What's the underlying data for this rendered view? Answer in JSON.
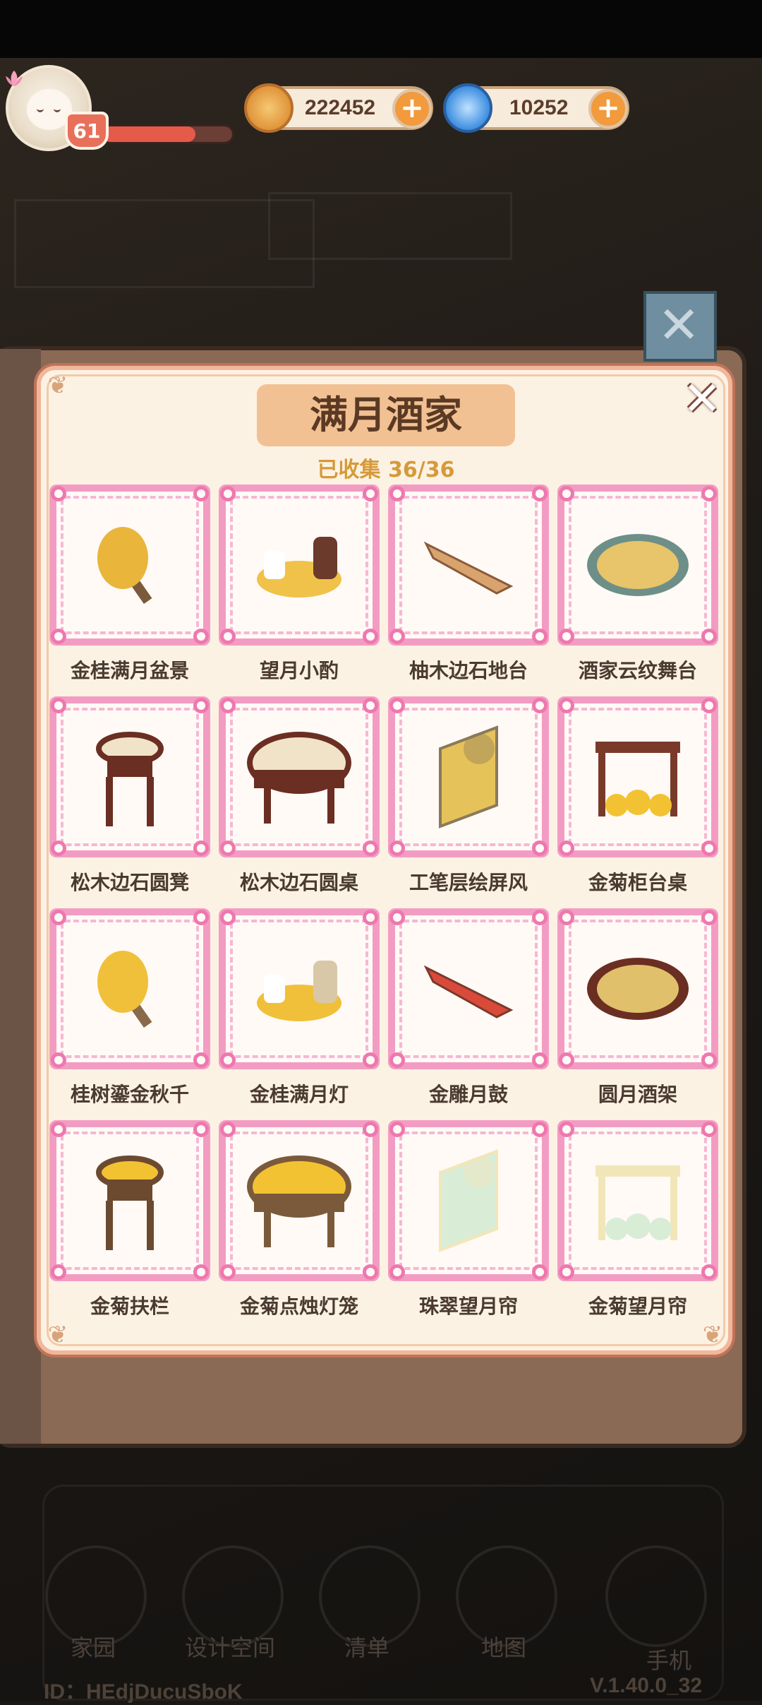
{
  "hud": {
    "level": "61",
    "xp_fraction": 0.72,
    "coins": "222452",
    "gems": "10252",
    "plus_symbol": "+"
  },
  "collection": {
    "title": "满月酒家",
    "progress": "已收集 36/36",
    "close_symbol": "✕",
    "items": [
      {
        "label": "金桂满月盆景",
        "icon": "golden-osmanthus-bonsai-icon"
      },
      {
        "label": "望月小酌",
        "icon": "wine-set-icon"
      },
      {
        "label": "柚木边石地台",
        "icon": "wooden-platform-icon"
      },
      {
        "label": "酒家云纹舞台",
        "icon": "round-stage-icon"
      },
      {
        "label": "松木边石圆凳",
        "icon": "round-stool-icon"
      },
      {
        "label": "松木边石圆桌",
        "icon": "round-table-icon"
      },
      {
        "label": "工笔层绘屏风",
        "icon": "painted-screen-icon"
      },
      {
        "label": "金菊柜台桌",
        "icon": "chrysanthemum-counter-icon"
      },
      {
        "label": "桂树鎏金秋千",
        "icon": "osmanthus-swing-icon"
      },
      {
        "label": "金桂满月灯",
        "icon": "osmanthus-lantern-icon"
      },
      {
        "label": "金雕月鼓",
        "icon": "moon-drum-icon"
      },
      {
        "label": "圆月酒架",
        "icon": "wine-rack-icon"
      },
      {
        "label": "金菊扶栏",
        "icon": "chrysanthemum-railing-icon"
      },
      {
        "label": "金菊点烛灯笼",
        "icon": "chrysanthemum-lantern-icon"
      },
      {
        "label": "珠翠望月帘",
        "icon": "pearl-curtain-icon"
      },
      {
        "label": "金菊望月帘",
        "icon": "chrysanthemum-curtain-icon"
      }
    ]
  },
  "nav": {
    "items": [
      "家园",
      "设计空间",
      "清单",
      "地图",
      "手机"
    ]
  },
  "footer": {
    "uid": "ID：HEdjDucuSboK",
    "version": "V.1.40.0_32"
  },
  "colors": {
    "panel_bg": "#fcf2e4",
    "frame_pink": "#f39cc3",
    "title_plate": "#f2c193",
    "progress_text": "#d59a3a",
    "coin_plus": "#f29a3c"
  }
}
